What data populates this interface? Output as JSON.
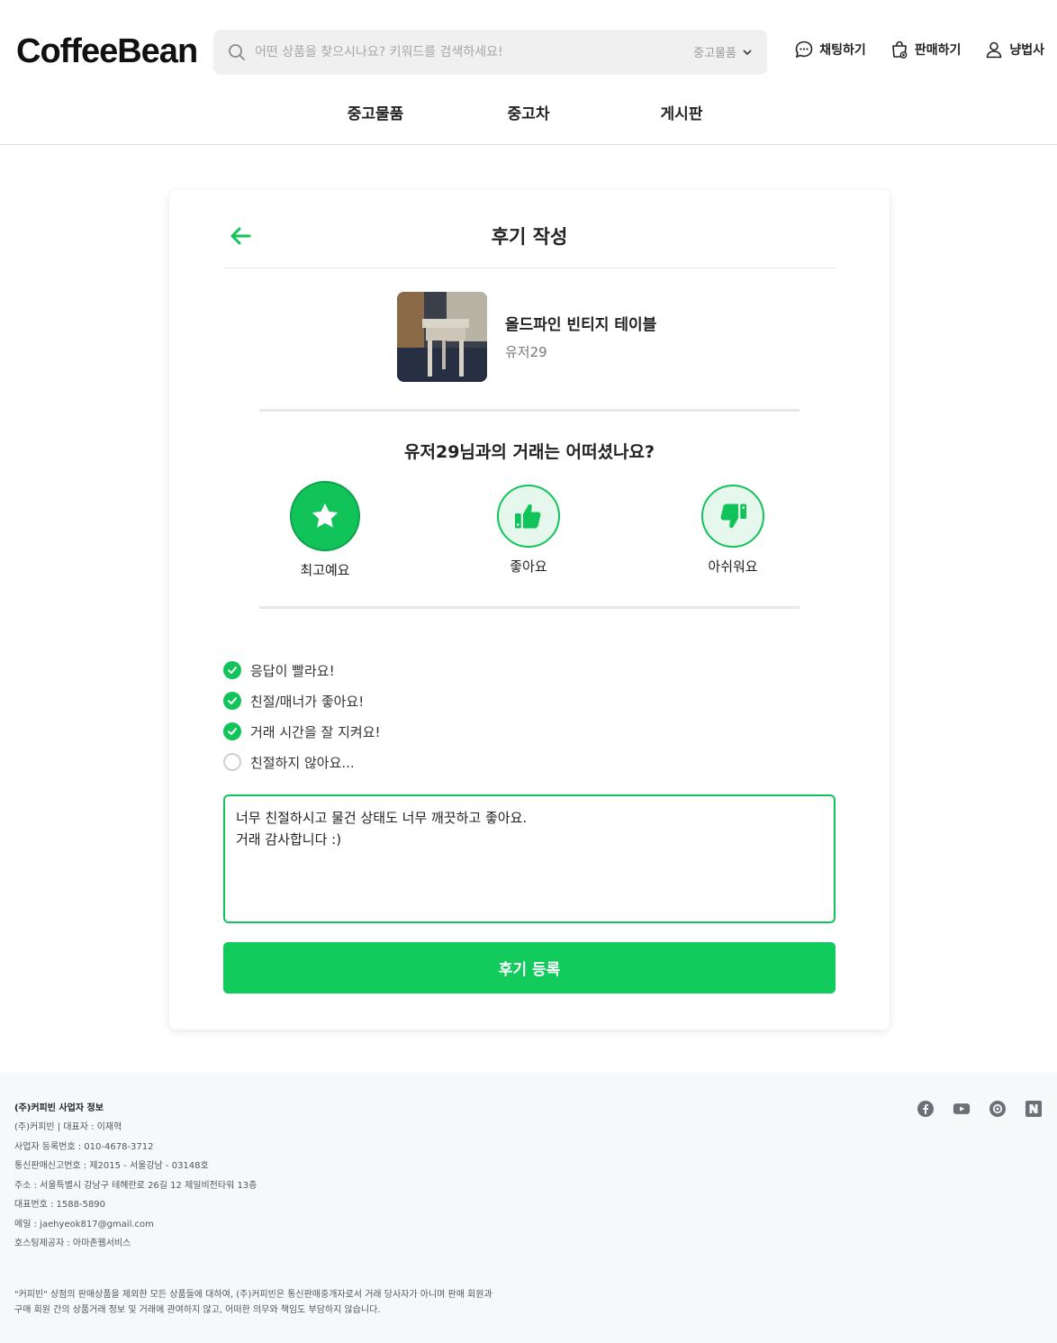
{
  "header": {
    "logo": "CoffeeBean",
    "search_placeholder": "어떤 상품을 찾으시나요? 키워드를 검색하세요!",
    "search_category": "중고물품",
    "actions": {
      "chat": "채팅하기",
      "sell": "판매하기",
      "user": "냥법사"
    },
    "nav": [
      "중고물품",
      "중고차",
      "게시판"
    ]
  },
  "review": {
    "title": "후기 작성",
    "product": {
      "name": "올드파인 빈티지 테이블",
      "seller": "유저29"
    },
    "question": "유저29님과의 거래는 어떠셨나요?",
    "ratings": [
      {
        "label": "최고예요",
        "icon": "star-icon",
        "selected": true
      },
      {
        "label": "좋아요",
        "icon": "thumbs-up-icon",
        "selected": false
      },
      {
        "label": "아쉬워요",
        "icon": "thumbs-down-icon",
        "selected": false
      }
    ],
    "checklist": [
      {
        "label": "응답이 빨라요!",
        "checked": true
      },
      {
        "label": "친절/매너가 좋아요!",
        "checked": true
      },
      {
        "label": "거래 시간을 잘 지켜요!",
        "checked": true
      },
      {
        "label": "친절하지 않아요...",
        "checked": false
      }
    ],
    "text": "너무 친절하시고 물건 상태도 너무 깨끗하고 좋아요.\n거래 감사합니다 :)",
    "submit_label": "후기 등록"
  },
  "footer": {
    "title": "(주)커피빈 사업자 정보",
    "lines": [
      "(주)커피빈 | 대표자 : 이재혁",
      "사업자 등록번호 : 010-4678-3712",
      "통신판매신고번호 : 제2015 - 서울강남 - 03148호",
      "주소 : 서울특별시 강남구 테헤란로 26길 12 제일비전타워 13층",
      "대표번호 : 1588-5890",
      "메일 : jaehyeok817@gmail.com",
      "호스팅제공자 : 아마존웹서비스"
    ],
    "disclaimer": [
      "\"커피빈\" 상점의 판매상품을 제외한 모든 상품들에 대하여, (주)커피빈은 통신판매중개자로서 거래 당사자가 아니며 판매 회원과",
      "구매 회원 간의 상품거래 정보 및 거래에 관여하지 않고, 어떠한 의무와 책임도 부담하지 않습니다."
    ],
    "social": [
      "facebook-icon",
      "youtube-icon",
      "blog-icon",
      "naver-icon"
    ]
  },
  "colors": {
    "accent": "#11c45a",
    "accent_light": "#e6f8ed",
    "footer_bg": "#f7f8fa"
  }
}
